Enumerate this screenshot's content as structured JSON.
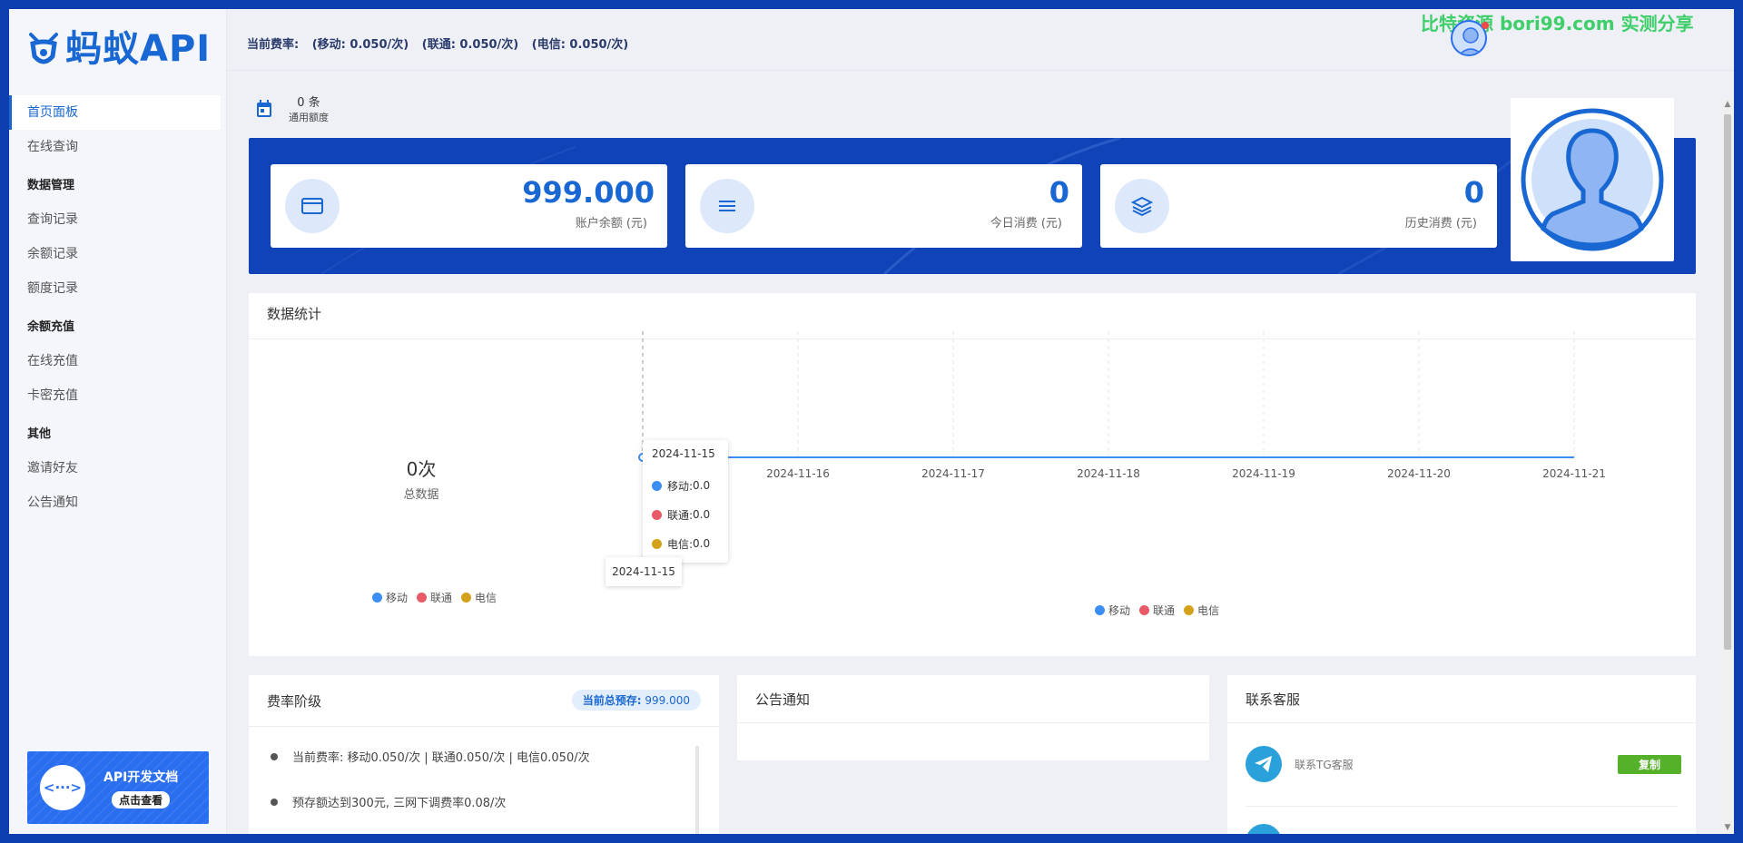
{
  "brand": {
    "logo_text": "蚂蚁API"
  },
  "sidebar": {
    "items": [
      {
        "label": "首页面板",
        "type": "item",
        "active": true
      },
      {
        "label": "在线查询",
        "type": "item"
      },
      {
        "label": "数据管理",
        "type": "group"
      },
      {
        "label": "查询记录",
        "type": "item"
      },
      {
        "label": "余额记录",
        "type": "item"
      },
      {
        "label": "额度记录",
        "type": "item"
      },
      {
        "label": "余额充值",
        "type": "group"
      },
      {
        "label": "在线充值",
        "type": "item"
      },
      {
        "label": "卡密充值",
        "type": "item"
      },
      {
        "label": "其他",
        "type": "group"
      },
      {
        "label": "邀请好友",
        "type": "item"
      },
      {
        "label": "公告通知",
        "type": "item"
      }
    ],
    "api_doc": {
      "icon": "<···>",
      "title": "API开发文档",
      "button": "点击查看"
    }
  },
  "header": {
    "rate_label": "当前费率:",
    "rate_mobile": "(移动: 0.050/次)",
    "rate_unicom": "(联通: 0.050/次)",
    "rate_telecom": "(电信: 0.050/次)",
    "watermark": "比特资源 bori99.com 实测分享"
  },
  "quota": {
    "value": "0 条",
    "label": "通用额度"
  },
  "stats": [
    {
      "value": "999.000",
      "label": "账户余额 (元)",
      "icon": "card-icon"
    },
    {
      "value": "0",
      "label": "今日消费 (元)",
      "icon": "list-icon"
    },
    {
      "value": "0",
      "label": "历史消费 (元)",
      "icon": "layers-icon"
    }
  ],
  "chart_panel": {
    "title": "数据统计",
    "total_value": "0次",
    "total_label": "总数据",
    "tooltip_date": "2024-11-15",
    "tooltip_rows": [
      {
        "label": "移动:",
        "value": "0.0"
      },
      {
        "label": "联通:",
        "value": "0.0"
      },
      {
        "label": "电信:",
        "value": "0.0"
      }
    ],
    "axis_pointer_label": "2024-11-15"
  },
  "chart_data": [
    {
      "type": "pie",
      "title": "",
      "categories": [
        "移动",
        "联通",
        "电信"
      ],
      "values": [
        0,
        0,
        0
      ],
      "legend": "bottom"
    },
    {
      "type": "line",
      "x": [
        "2024-11-15",
        "2024-11-16",
        "2024-11-17",
        "2024-11-18",
        "2024-11-19",
        "2024-11-20",
        "2024-11-21"
      ],
      "series": [
        {
          "name": "移动",
          "values": [
            0,
            0,
            0,
            0,
            0,
            0,
            0
          ]
        },
        {
          "name": "联通",
          "values": [
            0,
            0,
            0,
            0,
            0,
            0,
            0
          ]
        },
        {
          "name": "电信",
          "values": [
            0,
            0,
            0,
            0,
            0,
            0,
            0
          ]
        }
      ],
      "grid": true,
      "legend": "bottom"
    }
  ],
  "colors": {
    "mobile": "#3d8ef2",
    "unicom": "#e85a68",
    "telecom": "#d4a21a",
    "accent": "#1967d2",
    "banner": "#1043b8"
  },
  "rate_panel": {
    "title": "费率阶级",
    "badge_label": "当前总预存:",
    "badge_value": "999.000",
    "items": [
      "当前费率: 移动0.050/次 | 联通0.050/次 | 电信0.050/次",
      "预存额达到300元, 三网下调费率0.08/次"
    ]
  },
  "notice_panel": {
    "title": "公告通知"
  },
  "contact_panel": {
    "title": "联系客服",
    "contacts": [
      {
        "label": "联系TG客服",
        "button": "复制"
      }
    ]
  }
}
